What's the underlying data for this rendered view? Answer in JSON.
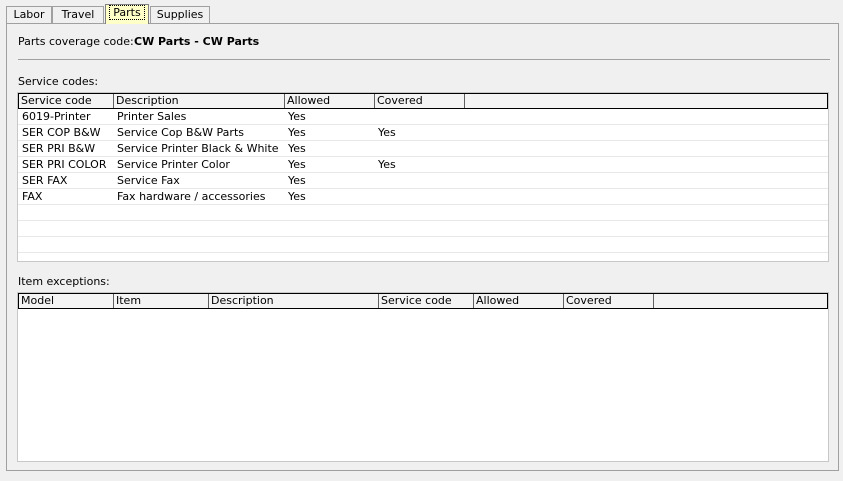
{
  "tabs": [
    {
      "label": "Labor"
    },
    {
      "label": "Travel"
    },
    {
      "label": "Parts"
    },
    {
      "label": "Supplies"
    }
  ],
  "coverage": {
    "label": "Parts coverage code:",
    "value": "CW Parts - CW Parts"
  },
  "service_codes": {
    "label": "Service codes:",
    "columns": [
      "Service code",
      "Description",
      "Allowed",
      "Covered"
    ],
    "rows": [
      {
        "code": "6019-Printer",
        "description": "Printer Sales",
        "allowed": "Yes",
        "covered": ""
      },
      {
        "code": "SER COP B&W",
        "description": "Service Cop B&W Parts",
        "allowed": "Yes",
        "covered": "Yes"
      },
      {
        "code": "SER PRI B&W",
        "description": "Service Printer Black & White",
        "allowed": "Yes",
        "covered": ""
      },
      {
        "code": "SER PRI COLOR",
        "description": "Service Printer Color",
        "allowed": "Yes",
        "covered": "Yes"
      },
      {
        "code": "SER FAX",
        "description": "Service Fax",
        "allowed": "Yes",
        "covered": ""
      },
      {
        "code": "FAX",
        "description": "Fax hardware / accessories",
        "allowed": "Yes",
        "covered": ""
      }
    ]
  },
  "item_exceptions": {
    "label": "Item exceptions:",
    "columns": [
      "Model",
      "Item",
      "Description",
      "Service code",
      "Allowed",
      "Covered"
    ]
  }
}
